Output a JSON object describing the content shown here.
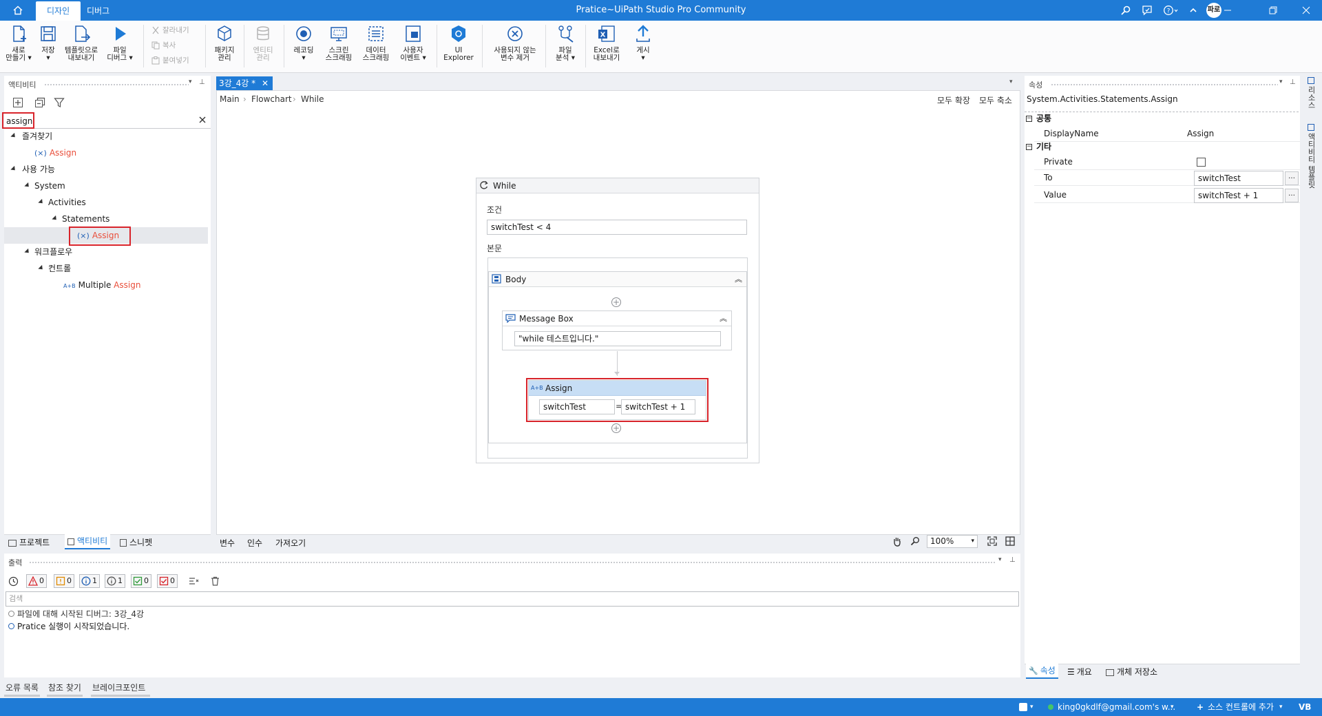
{
  "window": {
    "title": "Pratice~UiPath Studio Pro Community",
    "tabs": [
      "디자인",
      "디버그"
    ],
    "home_label": "홈",
    "user_initials": "파로"
  },
  "ribbon": {
    "buttons": [
      {
        "label1": "새로",
        "label2": "만들기 ▾"
      },
      {
        "label1": "저장",
        "label2": "▾"
      },
      {
        "label1": "템플릿으로",
        "label2": "내보내기"
      },
      {
        "label1": "파일",
        "label2": "디버그 ▾"
      },
      {
        "label1": "패키지",
        "label2": "관리"
      },
      {
        "label1": "엔티티",
        "label2": "관리"
      },
      {
        "label1": "레코딩",
        "label2": "▾"
      },
      {
        "label1": "스크린",
        "label2": "스크래핑"
      },
      {
        "label1": "데이터",
        "label2": "스크래핑"
      },
      {
        "label1": "사용자",
        "label2": "이벤트 ▾"
      },
      {
        "label1": "UI",
        "label2": "Explorer"
      },
      {
        "label1": "사용되지 않는",
        "label2": "변수 제거"
      },
      {
        "label1": "파일",
        "label2": "분석 ▾"
      },
      {
        "label1": "Excel로",
        "label2": "내보내기"
      },
      {
        "label1": "게시",
        "label2": "▾"
      }
    ],
    "small": [
      "잘라내기",
      "복사",
      "붙여넣기"
    ]
  },
  "activities_panel": {
    "header": "액티비티",
    "search_value": "assign",
    "tree": {
      "favorites": "즐겨찾기",
      "fav_assign": "Assign",
      "available": "사용 가능",
      "system": "System",
      "activities": "Activities",
      "statements": "Statements",
      "stmt_assign": "Assign",
      "workflow": "워크플로우",
      "control": "컨트롤",
      "multiple_prefix": "Multiple ",
      "multiple_hl": "Assign"
    },
    "bottom_tabs": [
      "프로젝트",
      "액티비티",
      "스니펫"
    ]
  },
  "designer": {
    "tab_label": "3강_4강 *",
    "breadcrumb": [
      "Main",
      "Flowchart",
      "While"
    ],
    "expand_all": "모두 확장",
    "collapse_all": "모두 축소",
    "while_title": "While",
    "condition_label": "조건",
    "condition_value": "switchTest < 4",
    "body_label": "본문",
    "body_title": "Body",
    "msgbox_title": "Message Box",
    "msgbox_text": "\"while 테스트입니다.\"",
    "assign_title": "Assign",
    "assign_to": "switchTest",
    "assign_eq": "=",
    "assign_value": "switchTest + 1",
    "bottom_tabs": [
      "변수",
      "인수",
      "가져오기"
    ],
    "zoom": "100%"
  },
  "properties": {
    "header": "속성",
    "type_name": "System.Activities.Statements.Assign",
    "section_common": "공통",
    "section_misc": "기타",
    "rows": [
      {
        "key": "DisplayName",
        "value": "Assign"
      },
      {
        "key": "Private",
        "value": ""
      },
      {
        "key": "To",
        "value": "switchTest"
      },
      {
        "key": "Value",
        "value": "switchTest + 1"
      }
    ],
    "bottom_tabs": [
      "속성",
      "개요",
      "개체 저장소"
    ],
    "right_rail": [
      "리소스",
      "액티비티 템플릿"
    ]
  },
  "output": {
    "header": "출력",
    "counts": [
      "0",
      "0",
      "1",
      "1",
      "0",
      "0"
    ],
    "search_placeholder": "검색",
    "lines": [
      "파일에 대해 시작된 디버그: 3강_4강",
      "Pratice 실행이 시작되었습니다."
    ]
  },
  "bottom_tabs": [
    "오류 목록",
    "참조 찾기",
    "브레이크포인트"
  ],
  "statusbar": {
    "account": "king0gkdlf@gmail.com's w...",
    "source_control": "소스 컨트롤에 추가",
    "lang": "VB"
  },
  "colors": {
    "accent": "#1f7bd6",
    "highlight_text": "#e94e3a",
    "callout_red": "#d8232a"
  }
}
